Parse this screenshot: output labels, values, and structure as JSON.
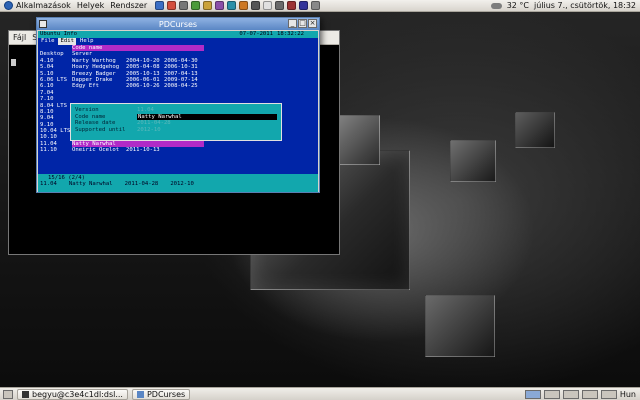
{
  "top_panel": {
    "menus": [
      "Alkalmazások",
      "Helyek",
      "Rendszer"
    ],
    "launcher_colors": [
      "#3b6fc5",
      "#d34f3d",
      "#777777",
      "#4b9a3a",
      "#caa23a",
      "#8a4fa8",
      "#2a8fa8",
      "#cc7722",
      "#555555",
      "#e0e0e0",
      "#6a6a6a",
      "#9b3333",
      "#333399",
      "#888888"
    ],
    "weather": "32 °C",
    "clock": "július 7., csütörtök, 18:32"
  },
  "terminal": {
    "menu": [
      "Fájl",
      "Sz"
    ]
  },
  "pdcurses": {
    "title": "PDCurses",
    "top_left": "Ubuntu Info",
    "date": "07-07-2011",
    "time": "18:32:22",
    "menu": [
      {
        "label": "File",
        "selected": false
      },
      {
        "label": "Edit",
        "selected": true
      },
      {
        "label": "Help",
        "selected": false
      }
    ],
    "header": {
      "c1": "",
      "c2": "Code name",
      "c3": "",
      "c4": ""
    },
    "rows": [
      {
        "c1": "Desktop",
        "c2": "Server",
        "c3": "",
        "c4": "",
        "hi": false
      },
      {
        "c1": "4.10",
        "c2": "Warty Warthog",
        "c3": "2004-10-20",
        "c4": "2006-04-30",
        "hi": false
      },
      {
        "c1": "5.04",
        "c2": "Hoary Hedgehog",
        "c3": "2005-04-08",
        "c4": "2006-10-31",
        "hi": false
      },
      {
        "c1": "5.10",
        "c2": "Breezy Badger",
        "c3": "2005-10-13",
        "c4": "2007-04-13",
        "hi": false
      },
      {
        "c1": "6.06 LTS",
        "c2": "Dapper Drake",
        "c3": "2006-06-01",
        "c4": "2009-07-14",
        "hi": false
      },
      {
        "c1": "6.10",
        "c2": "Edgy Eft",
        "c3": "2006-10-26",
        "c4": "2008-04-25",
        "hi": false
      },
      {
        "c1": "7.04",
        "c2": "",
        "c3": "",
        "c4": "",
        "hi": false
      },
      {
        "c1": "7.10",
        "c2": "",
        "c3": "",
        "c4": "",
        "hi": false
      },
      {
        "c1": "8.04 LTS",
        "c2": "",
        "c3": "",
        "c4": "",
        "hi": false
      },
      {
        "c1": "8.10",
        "c2": "",
        "c3": "",
        "c4": "",
        "hi": false
      },
      {
        "c1": "9.04",
        "c2": "",
        "c3": "",
        "c4": "",
        "hi": false
      },
      {
        "c1": "9.10",
        "c2": "",
        "c3": "",
        "c4": "",
        "hi": false
      },
      {
        "c1": "10.04 LTS",
        "c2": "Lucid Lynx",
        "c3": "2010-04-29",
        "c4": "2013-04",
        "hi": false
      },
      {
        "c1": "10.10",
        "c2": "Maverick Meerkat",
        "c3": "2010-10-10",
        "c4": "2012-04",
        "hi": false
      },
      {
        "c1": "11.04",
        "c2": "Natty Narwhal",
        "c3": "",
        "c4": "",
        "hi": true
      },
      {
        "c1": "11.10",
        "c2": "Oneiric Ocelot",
        "c3": "2011-10-13",
        "c4": "",
        "hi": false
      }
    ],
    "dialog": [
      {
        "label": "Version",
        "value": "11.04",
        "selected": false
      },
      {
        "label": "Code name",
        "value": "Natty Narwhal",
        "selected": true
      },
      {
        "label": "Release date",
        "value": "2011-04-28",
        "selected": false
      },
      {
        "label": "Supported until",
        "value": "2012-10",
        "selected": false
      }
    ],
    "status": {
      "position": "15/16 (2/4)",
      "version": "11.04",
      "codename": "Natty Narwhal",
      "release": "2011-04-28",
      "support": "2012-10"
    }
  },
  "bottom_panel": {
    "tasks": [
      "begyu@c3e4c1dl:dsl...",
      "PDCurses"
    ],
    "lang": "Hun"
  }
}
